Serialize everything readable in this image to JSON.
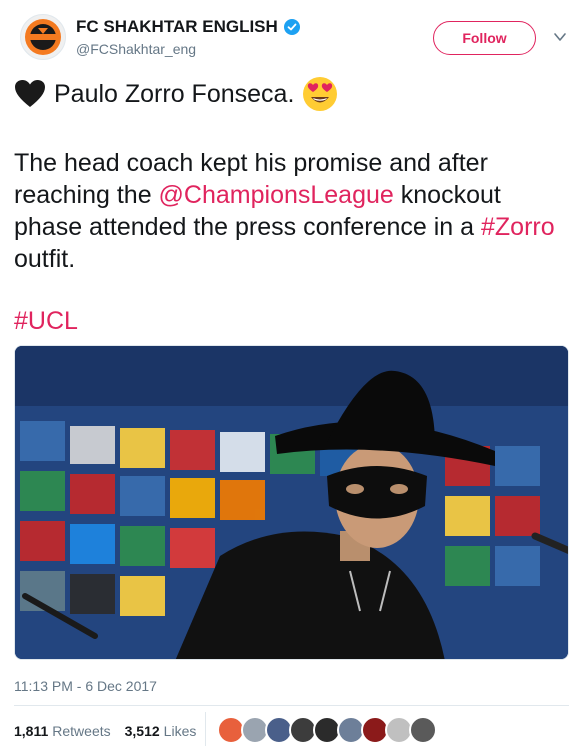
{
  "account": {
    "display_name": "FC SHAKHTAR ENGLISH",
    "handle": "@FCShakhtar_eng",
    "logo_text": "ШАХТАР",
    "follow_label": "Follow"
  },
  "tweet": {
    "line1_text": "Paulo Zorro Fonseca.",
    "body_part1": "The head coach kept his promise and after reaching the ",
    "mention": "@ChampionsLeague",
    "body_part2": " knockout phase attended the press conference in a ",
    "hashtag_zorro": "#Zorro",
    "body_part3": " outfit.",
    "hashtag_ucl": "#UCL",
    "timestamp": "11:13 PM - 6 Dec 2017"
  },
  "stats": {
    "retweets_count": "1,811",
    "retweets_label": "Retweets",
    "likes_count": "3,512",
    "likes_label": "Likes"
  },
  "likers": [
    {
      "name": "liker-1",
      "color": "#e8603c"
    },
    {
      "name": "liker-2",
      "color": "#9aa4b0"
    },
    {
      "name": "liker-3",
      "color": "#4a5f8a"
    },
    {
      "name": "liker-4",
      "color": "#3c3c3c"
    },
    {
      "name": "liker-5",
      "color": "#2b2b2b"
    },
    {
      "name": "liker-6",
      "color": "#6d7f99"
    },
    {
      "name": "liker-7",
      "color": "#8b1a1a"
    },
    {
      "name": "liker-8",
      "color": "#c0c0c0"
    },
    {
      "name": "liker-9",
      "color": "#5a5a5a"
    }
  ],
  "colors": {
    "accent": "#e0245e",
    "verified": "#1da1f2",
    "text": "#14171a",
    "secondary": "#657786"
  }
}
